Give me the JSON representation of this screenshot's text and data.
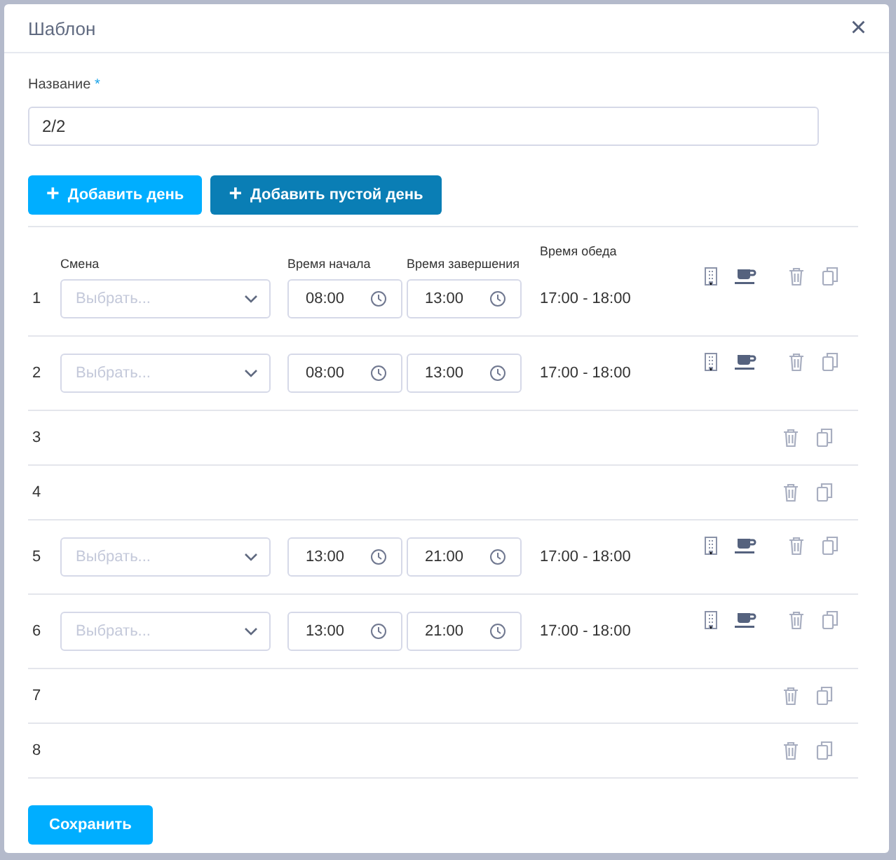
{
  "dialog": {
    "title": "Шаблон",
    "close": "×"
  },
  "name_field": {
    "label": "Название",
    "required_mark": "*",
    "value": "2/2"
  },
  "buttons": [
    {
      "label": "Добавить день",
      "icon": "+",
      "kind": "primary"
    },
    {
      "label": "Добавить пустой день",
      "icon": "+",
      "kind": "dark"
    }
  ],
  "columns": [
    "Смена",
    "Время начала",
    "Время завершения",
    "Время обеда"
  ],
  "days": [
    {
      "number": "1",
      "kind": "shift",
      "shift_placeholder": "Выбрать...",
      "start": "08:00",
      "end": "13:00",
      "lunch": "17:00 - 18:00"
    },
    {
      "number": "2",
      "kind": "shift",
      "shift_placeholder": "Выбрать...",
      "start": "08:00",
      "end": "13:00",
      "lunch": "17:00 - 18:00"
    },
    {
      "number": "3",
      "kind": "empty"
    },
    {
      "number": "4",
      "kind": "empty"
    },
    {
      "number": "5",
      "kind": "shift",
      "shift_placeholder": "Выбрать...",
      "start": "13:00",
      "end": "21:00",
      "lunch": "17:00 - 18:00"
    },
    {
      "number": "6",
      "kind": "shift",
      "shift_placeholder": "Выбрать...",
      "start": "13:00",
      "end": "21:00",
      "lunch": "17:00 - 18:00"
    },
    {
      "number": "7",
      "kind": "empty"
    },
    {
      "number": "8",
      "kind": "empty"
    }
  ],
  "save_button": "Сохранить"
}
